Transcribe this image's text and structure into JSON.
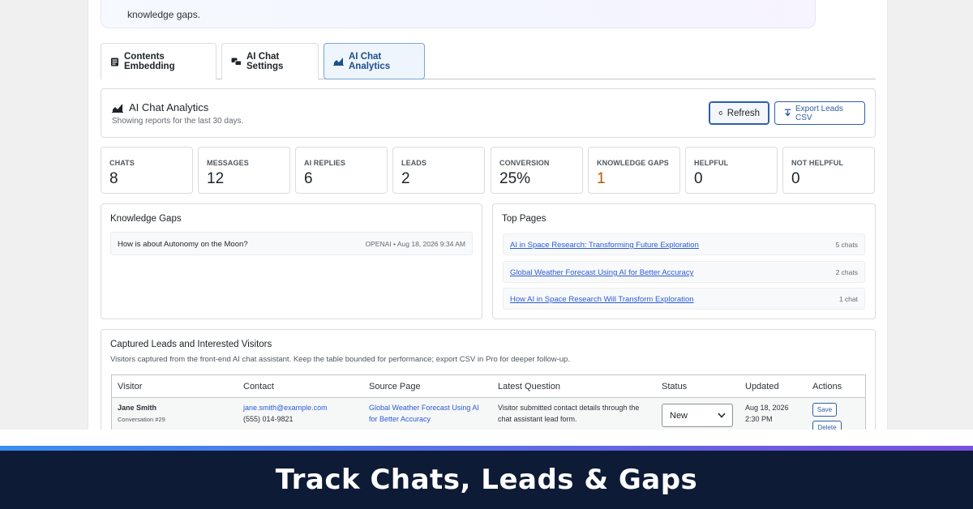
{
  "notice": {
    "text": "knowledge gaps."
  },
  "tabs": [
    {
      "label": "Contents Embedding"
    },
    {
      "label": "AI Chat Settings"
    },
    {
      "label": "AI Chat Analytics"
    }
  ],
  "header": {
    "title": "AI Chat Analytics",
    "subtitle": "Showing reports for the last 30 days.",
    "refresh_label": "Refresh",
    "export_label": "Export Leads CSV"
  },
  "stats": [
    {
      "label": "CHATS",
      "value": "8"
    },
    {
      "label": "MESSAGES",
      "value": "12"
    },
    {
      "label": "AI REPLIES",
      "value": "6"
    },
    {
      "label": "LEADS",
      "value": "2"
    },
    {
      "label": "CONVERSION",
      "value": "25%"
    },
    {
      "label": "KNOWLEDGE GAPS",
      "value": "1"
    },
    {
      "label": "HELPFUL",
      "value": "0"
    },
    {
      "label": "NOT HELPFUL",
      "value": "0"
    }
  ],
  "knowledge_gaps": {
    "title": "Knowledge Gaps",
    "items": [
      {
        "question": "How is about Autonomy on the Moon?",
        "meta": "OPENAI • Aug 18, 2026 9:34 AM"
      }
    ]
  },
  "top_pages": {
    "title": "Top Pages",
    "items": [
      {
        "title": "AI in Space Research: Transforming Future Exploration",
        "count": "5 chats"
      },
      {
        "title": "Global Weather Forecast Using AI for Better Accuracy",
        "count": "2 chats"
      },
      {
        "title": "How AI in Space Research Will Transform Exploration",
        "count": "1 chat"
      }
    ]
  },
  "leads": {
    "title": "Captured Leads and Interested Visitors",
    "subtitle": "Visitors captured from the front-end AI chat assistant. Keep the table bounded for performance; export CSV in Pro for deeper follow-up.",
    "columns": [
      "Visitor",
      "Contact",
      "Source Page",
      "Latest Question",
      "Status",
      "Updated",
      "Actions"
    ],
    "rows": [
      {
        "name": "Jane Smith",
        "conversation": "Conversation #29",
        "email": "jane.smith@example.com",
        "phone": "(555) 014-9821",
        "source_line1": "Global Weather Forecast Using AI",
        "source_line2": "for Better Accuracy",
        "question_line1": "Visitor submitted contact details through the",
        "question_line2": "chat assistant lead form.",
        "status": "New",
        "updated_date": "Aug 18, 2026",
        "updated_time": "2:30 PM",
        "save_label": "Save",
        "delete_label": "Delete"
      }
    ]
  },
  "footer": {
    "title": "Track Chats, Leads & Gaps"
  },
  "colors": {
    "accent": "#2f5ea8",
    "link": "#2a5bd7",
    "warn": "#b35900",
    "footer_bg": "#0e1b36"
  }
}
